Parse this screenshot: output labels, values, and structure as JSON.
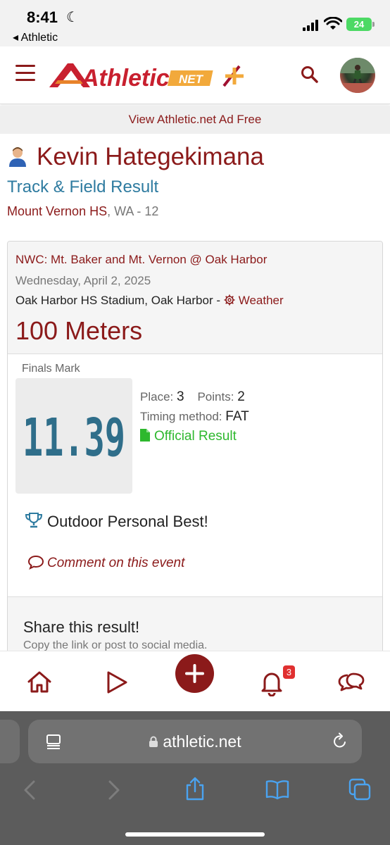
{
  "status_bar": {
    "time": "8:41",
    "back_label": "◂ Athletic",
    "battery": "24"
  },
  "header": {
    "logo_text": "Athletic",
    "logo_net": "NET",
    "ad_free_link": "View Athletic.net Ad Free"
  },
  "athlete": {
    "name": "Kevin Hategekimana",
    "result_type": "Track & Field Result",
    "school": "Mount Vernon HS",
    "school_suffix": ", WA - 12"
  },
  "result": {
    "meet_name": "NWC: Mt. Baker and Mt. Vernon @ Oak Harbor",
    "date": "Wednesday, April 2, 2025",
    "venue": "Oak Harbor HS Stadium, Oak Harbor - ",
    "weather_label": "Weather",
    "event": "100 Meters",
    "finals_label": "Finals Mark",
    "mark": "11.39",
    "place_label": "Place:",
    "place": "3",
    "points_label": "Points:",
    "points": "2",
    "timing_label": "Timing method:",
    "timing": "FAT",
    "official_label": "Official Result",
    "pb_label": "Outdoor Personal Best!",
    "comment_label": "Comment on this event",
    "share_title": "Share this result!",
    "share_sub": "Copy the link or post to social media."
  },
  "bottom_nav": {
    "notification_count": "3"
  },
  "browser": {
    "url": "athletic.net"
  },
  "colors": {
    "brand": "#8b1a1a",
    "link_blue": "#2e7ba0",
    "success": "#2eb82e",
    "mark_digits": "#2f6e8a"
  }
}
